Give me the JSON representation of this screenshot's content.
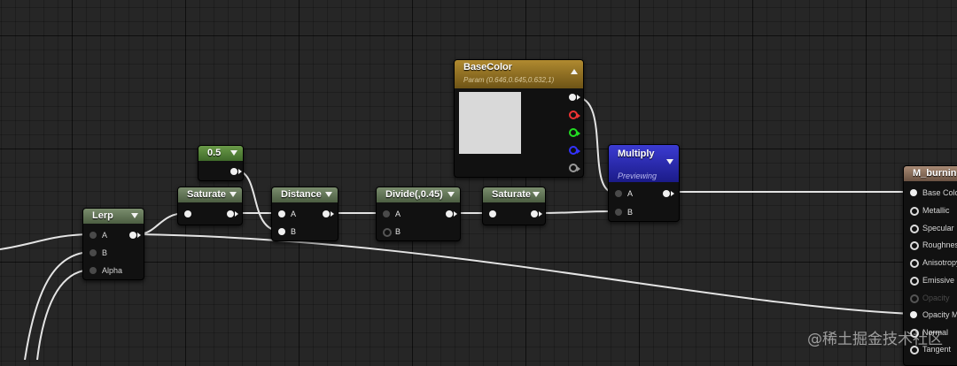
{
  "nodes": {
    "const": {
      "title": "0.5"
    },
    "lerp": {
      "title": "Lerp",
      "pins": [
        "A",
        "B",
        "Alpha"
      ]
    },
    "saturate1": {
      "title": "Saturate"
    },
    "distance": {
      "title": "Distance",
      "pins": [
        "A",
        "B"
      ]
    },
    "divide": {
      "title": "Divide(,0.45)",
      "pins": [
        "A",
        "B"
      ]
    },
    "saturate2": {
      "title": "Saturate"
    },
    "basecolor": {
      "title": "BaseColor",
      "subtitle": "Param (0.646,0.645,0.632,1)",
      "swatch": "#d9d9d9"
    },
    "multiply": {
      "title": "Multiply",
      "subtitle": "Previewing",
      "pins": [
        "A",
        "B"
      ]
    },
    "material": {
      "title": "M_burning",
      "pins": [
        "Base Color",
        "Metallic",
        "Specular",
        "Roughness",
        "Anisotropy",
        "Emissive Color",
        "Opacity",
        "Opacity Mask",
        "Normal",
        "Tangent"
      ]
    }
  },
  "watermark": "@稀土掘金技术社区",
  "colors": {
    "canvas": "#262626",
    "constant_header": "#5a8a3c",
    "basecolor_header": "#9a7a28",
    "multiply_header": "#2b2bb0",
    "material_header": "#8a6d56"
  }
}
